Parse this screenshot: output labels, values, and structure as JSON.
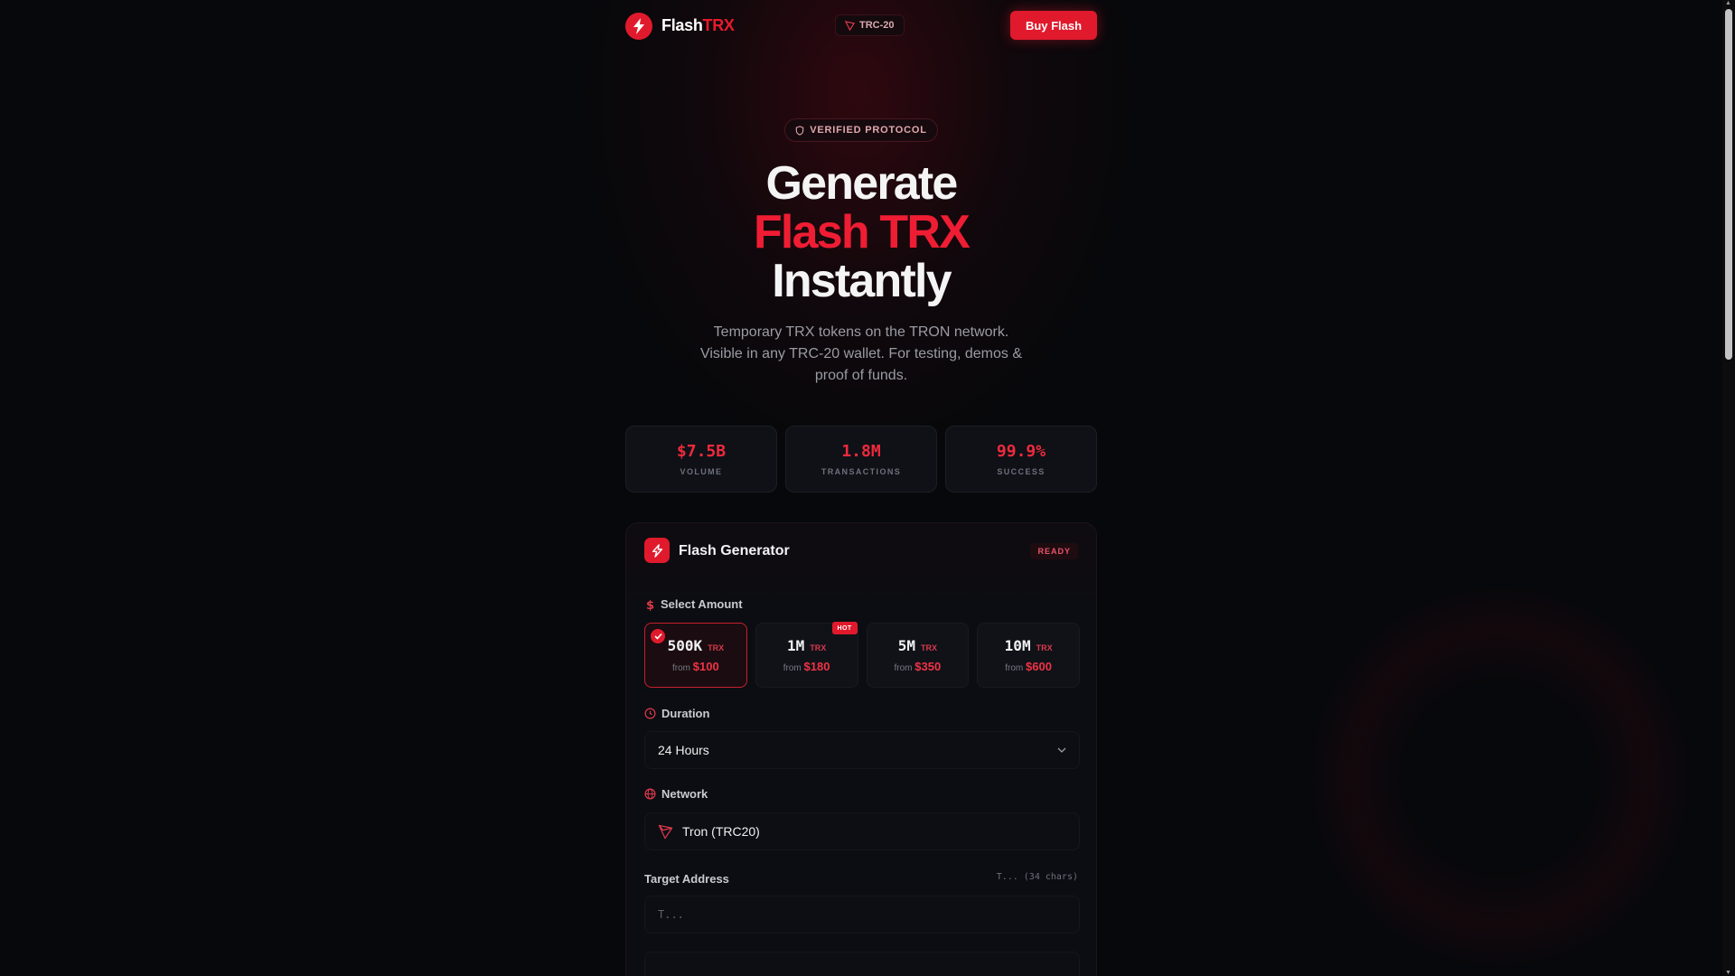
{
  "header": {
    "brand_white": "Flash",
    "brand_red": "TRX",
    "network_chip": "TRC-20",
    "buy_label": "Buy Flash"
  },
  "hero": {
    "badge": "VERIFIED PROTOCOL",
    "title_line1": "Generate",
    "title_line2": "Flash TRX",
    "title_line3": "Instantly",
    "subtitle": "Temporary TRX tokens on the TRON network. Visible in any TRC-20 wallet. For testing, demos & proof of funds."
  },
  "stats": [
    {
      "value": "$7.5B",
      "label": "VOLUME"
    },
    {
      "value": "1.8M",
      "label": "TRANSACTIONS"
    },
    {
      "value": "99.9%",
      "label": "SUCCESS"
    }
  ],
  "generator": {
    "title": "Flash Generator",
    "status": "READY",
    "amount_label": "Select Amount",
    "amounts": [
      {
        "amount": "500K",
        "unit": "TRX",
        "from": "from",
        "price": "$100",
        "selected": true
      },
      {
        "amount": "1M",
        "unit": "TRX",
        "from": "from",
        "price": "$180",
        "badge": "HOT"
      },
      {
        "amount": "5M",
        "unit": "TRX",
        "from": "from",
        "price": "$350"
      },
      {
        "amount": "10M",
        "unit": "TRX",
        "from": "from",
        "price": "$600"
      }
    ],
    "duration_label": "Duration",
    "duration_value": "24 Hours",
    "network_label": "Network",
    "network_value": "Tron (TRC20)",
    "address_label": "Target Address",
    "address_hint": "T... (34 chars)",
    "address_placeholder": "T...",
    "address_value": ""
  },
  "colors": {
    "accent": "#e01a2c",
    "background": "#07080b",
    "card": "#0f1117"
  }
}
